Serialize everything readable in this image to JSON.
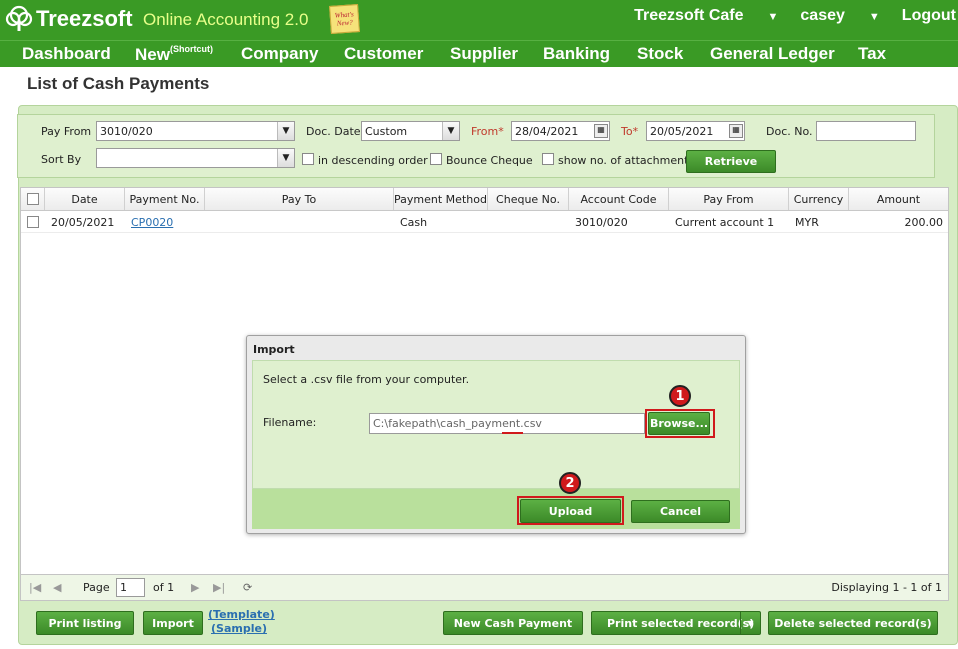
{
  "header": {
    "brand": "Treezsoft",
    "subtitle": "Online Accounting 2.0",
    "whats_new": "What's New?",
    "company": "Treezsoft Cafe",
    "user": "casey",
    "logout": "Logout"
  },
  "menu": {
    "dashboard": "Dashboard",
    "new": "New",
    "new_sup": "(Shortcut)",
    "company": "Company",
    "customer": "Customer",
    "supplier": "Supplier",
    "banking": "Banking",
    "stock": "Stock",
    "general_ledger": "General Ledger",
    "tax": "Tax"
  },
  "page_title": "List of Cash Payments",
  "filters": {
    "pay_from_label": "Pay From",
    "pay_from_value": "3010/020",
    "doc_date_label": "Doc. Date",
    "doc_date_value": "Custom",
    "from_label": "From*",
    "from_value": "28/04/2021",
    "to_label": "To*",
    "to_value": "20/05/2021",
    "doc_no_label": "Doc. No.",
    "doc_no_value": "",
    "sort_by_label": "Sort By",
    "sort_by_value": "",
    "descending_label": "in descending order",
    "bounce_cheque_label": "Bounce Cheque",
    "show_attachment_label": "show no. of attachment",
    "retrieve": "Retrieve"
  },
  "grid": {
    "columns": [
      "Date",
      "Payment No.",
      "Pay To",
      "Payment Method",
      "Cheque No.",
      "Account Code",
      "Pay From",
      "Currency",
      "Amount"
    ],
    "rows": [
      {
        "date": "20/05/2021",
        "payment_no": "CP0020",
        "pay_to": "",
        "method": "Cash",
        "cheque_no": "",
        "account_code": "3010/020",
        "pay_from": "Current account 1",
        "currency": "MYR",
        "amount": "200.00"
      }
    ]
  },
  "pager": {
    "page_label": "Page",
    "page_value": "1",
    "of_label": "of 1",
    "displaying": "Displaying 1 - 1 of 1"
  },
  "dialog": {
    "title": "Import",
    "instruction": "Select a .csv file from your computer.",
    "filename_label": "Filename:",
    "filename_value": "C:\\fakepath\\cash_payment.csv",
    "browse": "Browse...",
    "upload": "Upload",
    "cancel": "Cancel",
    "step1": "1",
    "step2": "2",
    "accent": "#d0191c"
  },
  "bottom": {
    "print_listing": "Print listing",
    "import": "Import",
    "template": "(Template)",
    "sample": "(Sample)",
    "new_cash_payment": "New Cash Payment",
    "print_selected": "Print selected record(s)",
    "delete_selected": "Delete selected record(s)"
  },
  "colors": {
    "brand_green": "#3a9a25",
    "panel_green": "#d6ecc4",
    "button_green": "#4a9e34"
  }
}
